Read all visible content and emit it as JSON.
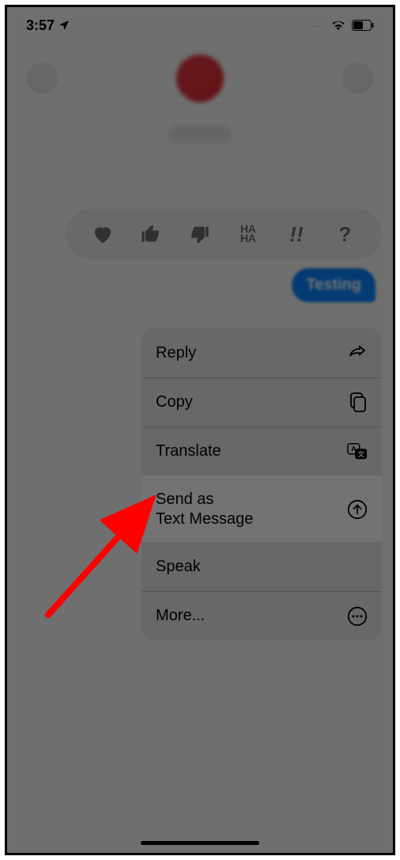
{
  "status": {
    "time": "3:57",
    "location_active": true,
    "wifi": true,
    "battery_level": 55
  },
  "message": {
    "text": "Testing"
  },
  "tapbacks": [
    {
      "name": "heart",
      "glyph": "♥"
    },
    {
      "name": "thumbs-up",
      "glyph": "👍"
    },
    {
      "name": "thumbs-down",
      "glyph": "👎"
    },
    {
      "name": "haha",
      "glyph": "HA\nHA"
    },
    {
      "name": "exclaim",
      "glyph": "!!"
    },
    {
      "name": "question",
      "glyph": "?"
    }
  ],
  "menu": {
    "reply": "Reply",
    "copy": "Copy",
    "translate": "Translate",
    "send_as_text": "Send as\nText Message",
    "speak": "Speak",
    "more": "More..."
  },
  "annotation": {
    "arrow_color": "#ff0000"
  }
}
